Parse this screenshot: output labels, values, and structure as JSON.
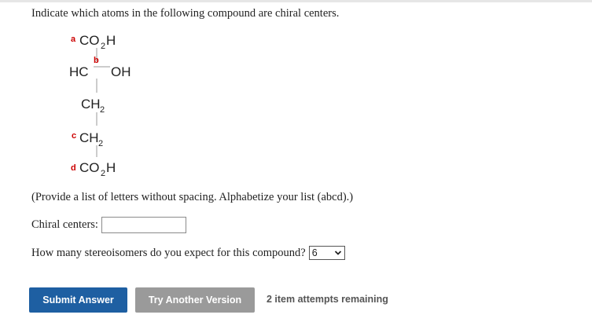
{
  "question": "Indicate which atoms in the following compound are chiral centers.",
  "molecule": {
    "tag_a": "a",
    "tag_b": "b",
    "tag_c": "c",
    "tag_d": "d",
    "top_group": "CO",
    "top_sub": "2",
    "top_h": "H",
    "hc": "HC",
    "oh": "OH",
    "ch2_1": "CH",
    "ch2_1_sub": "2",
    "ch2_2": "CH",
    "ch2_2_sub": "2",
    "bottom_group": "CO",
    "bottom_sub": "2",
    "bottom_h": "H"
  },
  "instructions": "(Provide a list of letters without spacing. Alphabetize your list (abcd).)",
  "chiral_label": "Chiral centers:",
  "chiral_value": "",
  "stereo_label": "How many stereoisomers do you expect for this compound?",
  "stereo_selected": "6",
  "buttons": {
    "submit": "Submit Answer",
    "try": "Try Another Version"
  },
  "attempts": "2 item attempts remaining",
  "colors": {
    "submit_bg": "#1e5fa2",
    "try_bg": "#9a9a9a",
    "tag": "#cc0000"
  },
  "icons": {
    "select_arrow": "chevron-down-icon"
  }
}
